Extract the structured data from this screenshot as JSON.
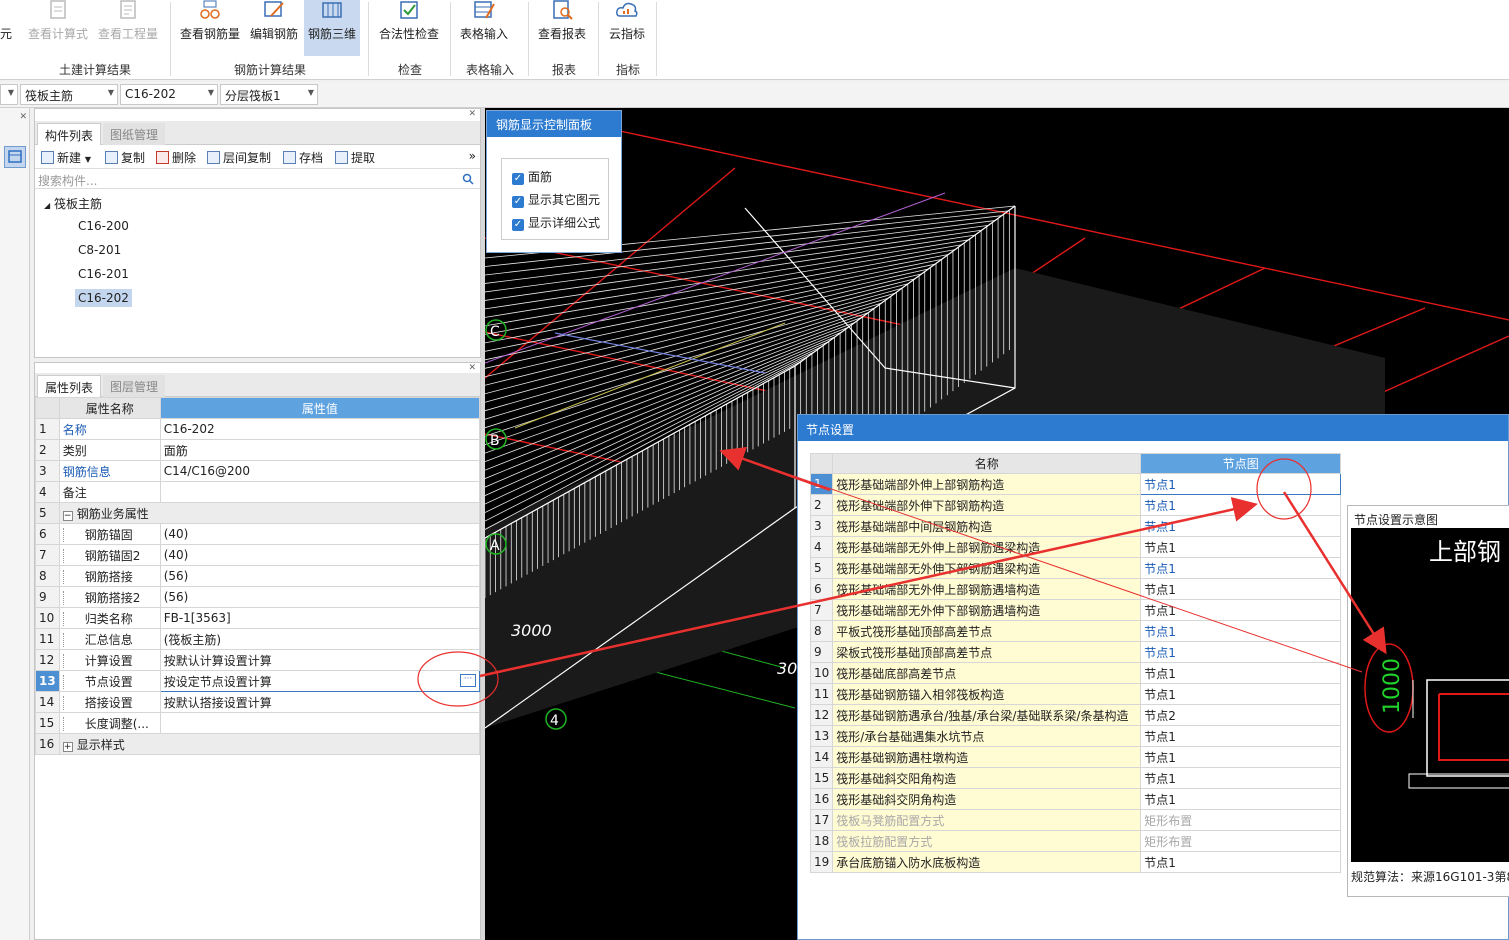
{
  "ribbon": {
    "partial_left": "元",
    "buttons": [
      {
        "label": "查看计算式",
        "state": "disabled",
        "icon": "formula-icon"
      },
      {
        "label": "查看工程量",
        "state": "disabled",
        "icon": "quantity-icon"
      },
      {
        "label": "查看钢筋量",
        "state": "normal",
        "icon": "rebar-quantity-icon"
      },
      {
        "label": "编辑钢筋",
        "state": "normal",
        "icon": "edit-rebar-icon"
      },
      {
        "label": "钢筋三维",
        "state": "active",
        "icon": "rebar-3d-icon"
      },
      {
        "label": "合法性检查",
        "state": "normal",
        "icon": "check-icon"
      },
      {
        "label": "表格输入",
        "state": "normal",
        "icon": "table-input-icon"
      },
      {
        "label": "查看报表",
        "state": "normal",
        "icon": "report-icon"
      },
      {
        "label": "云指标",
        "state": "normal",
        "icon": "cloud-index-icon"
      }
    ],
    "groups": [
      "土建计算结果",
      "钢筋计算结果",
      "检查",
      "表格输入",
      "报表",
      "指标"
    ]
  },
  "selectors": {
    "first": "",
    "type": "筏板主筋",
    "name": "C16-202",
    "layer": "分层筏板1"
  },
  "component_panel": {
    "tabs": [
      "构件列表",
      "图纸管理"
    ],
    "toolbar": [
      "新建",
      "复制",
      "删除",
      "层间复制",
      "存档",
      "提取"
    ],
    "search_placeholder": "搜索构件...",
    "tree_root": "筏板主筋",
    "tree_items": [
      "C16-200",
      "C8-201",
      "C16-201",
      "C16-202"
    ],
    "selected": "C16-202"
  },
  "property_panel": {
    "tabs": [
      "属性列表",
      "图层管理"
    ],
    "headers": [
      "属性名称",
      "属性值"
    ],
    "rows": [
      {
        "num": "1",
        "name": "名称",
        "value": "C16-202"
      },
      {
        "num": "2",
        "name": "类别",
        "value": "面筋"
      },
      {
        "num": "3",
        "name": "钢筋信息",
        "value": "C14/C16@200"
      },
      {
        "num": "4",
        "name": "备注",
        "value": ""
      },
      {
        "num": "5",
        "name": "钢筋业务属性",
        "value": ""
      },
      {
        "num": "6",
        "name": "钢筋锚固",
        "value": "(40)"
      },
      {
        "num": "7",
        "name": "钢筋锚固2",
        "value": "(40)"
      },
      {
        "num": "8",
        "name": "钢筋搭接",
        "value": "(56)"
      },
      {
        "num": "9",
        "name": "钢筋搭接2",
        "value": "(56)"
      },
      {
        "num": "10",
        "name": "归类名称",
        "value": "FB-1[3563]"
      },
      {
        "num": "11",
        "name": "汇总信息",
        "value": "(筏板主筋)"
      },
      {
        "num": "12",
        "name": "计算设置",
        "value": "按默认计算设置计算"
      },
      {
        "num": "13",
        "name": "节点设置",
        "value": "按设定节点设置计算"
      },
      {
        "num": "14",
        "name": "搭接设置",
        "value": "按默认搭接设置计算"
      },
      {
        "num": "15",
        "name": "长度调整(...",
        "value": ""
      },
      {
        "num": "16",
        "name": "显示样式",
        "value": ""
      }
    ]
  },
  "rebar_display_panel": {
    "title": "钢筋显示控制面板",
    "options": [
      "面筋",
      "显示其它图元",
      "显示详细公式"
    ]
  },
  "viewport": {
    "axis_labels": [
      "C",
      "B",
      "A",
      "4"
    ],
    "dims": [
      "3000",
      "30"
    ]
  },
  "node_dialog": {
    "title": "节点设置",
    "headers": [
      "名称",
      "节点图"
    ],
    "rows": [
      {
        "num": "1",
        "name": "筏形基础端部外伸上部钢筋构造",
        "node": "节点1"
      },
      {
        "num": "2",
        "name": "筏形基础端部外伸下部钢筋构造",
        "node": "节点1"
      },
      {
        "num": "3",
        "name": "筏形基础端部中间层钢筋构造",
        "node": "节点1"
      },
      {
        "num": "4",
        "name": "筏形基础端部无外伸上部钢筋遇梁构造",
        "node": "节点1"
      },
      {
        "num": "5",
        "name": "筏形基础端部无外伸下部钢筋遇梁构造",
        "node": "节点1"
      },
      {
        "num": "6",
        "name": "筏形基础端部无外伸上部钢筋遇墙构造",
        "node": "节点1"
      },
      {
        "num": "7",
        "name": "筏形基础端部无外伸下部钢筋遇墙构造",
        "node": "节点1"
      },
      {
        "num": "8",
        "name": "平板式筏形基础顶部高差节点",
        "node": "节点1"
      },
      {
        "num": "9",
        "name": "梁板式筏形基础顶部高差节点",
        "node": "节点1"
      },
      {
        "num": "10",
        "name": "筏形基础底部高差节点",
        "node": "节点1"
      },
      {
        "num": "11",
        "name": "筏形基础钢筋锚入相邻筏板构造",
        "node": "节点1"
      },
      {
        "num": "12",
        "name": "筏形基础钢筋遇承台/独基/承台梁/基础联系梁/条基构造",
        "node": "节点2"
      },
      {
        "num": "13",
        "name": "筏形/承台基础遇集水坑节点",
        "node": "节点1"
      },
      {
        "num": "14",
        "name": "筏形基础钢筋遇柱墩构造",
        "node": "节点1"
      },
      {
        "num": "15",
        "name": "筏形基础斜交阳角构造",
        "node": "节点1"
      },
      {
        "num": "16",
        "name": "筏形基础斜交阴角构造",
        "node": "节点1"
      },
      {
        "num": "17",
        "name": "筏板马凳筋配置方式",
        "node": "矩形布置"
      },
      {
        "num": "18",
        "name": "筏板拉筋配置方式",
        "node": "矩形布置"
      },
      {
        "num": "19",
        "name": "承台底筋锚入防水底板构造",
        "node": "节点1"
      }
    ],
    "preview_title": "节点设置示意图",
    "preview_heading": "上部钢",
    "preview_dim": "1000",
    "preview_footer": "规范算法：来源16G101-3第8"
  }
}
